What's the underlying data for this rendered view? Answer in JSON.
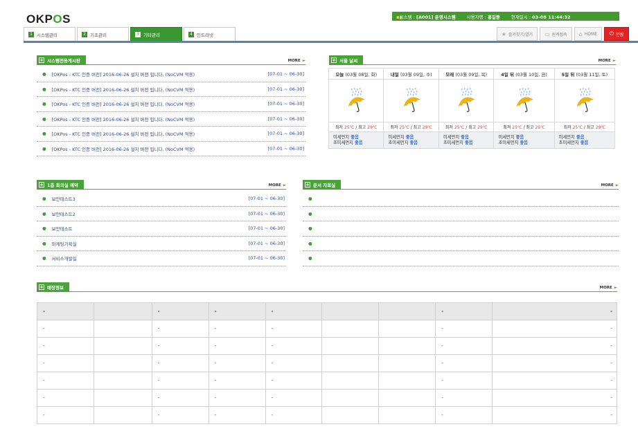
{
  "logo": {
    "left": "OKP",
    "o": "O",
    "right": "S"
  },
  "topinfo": {
    "system": "시스템 :",
    "system_value": "[A001] 운영시스템",
    "user": "사용자명 :",
    "user_value": "홍길동",
    "datetime": "현재일시 :",
    "datetime_value": "03-08 11:44:32"
  },
  "tabs": [
    {
      "num": "1",
      "label": "시스템관리"
    },
    {
      "num": "2",
      "label": "기초관리"
    },
    {
      "num": "3",
      "label": "기타관리"
    },
    {
      "num": "4",
      "label": "인트라넷"
    }
  ],
  "topbuttons": {
    "favorite": "즐겨찾기/열기",
    "remote": "원격접속",
    "home": "HOME",
    "close": "안뵘"
  },
  "notice": {
    "title": "시스템전용게시판",
    "more": "MORE",
    "items": [
      {
        "text": "[OKPos - KTC 인증 버전] 2016-06-26 설치 버전 입니다. (NoCVM 적용)",
        "date": "[07-01 ~ 06-30]"
      },
      {
        "text": "[OKPos - KTC 인증 버전] 2016-06-26 설치 버전 입니다. (NoCVM 적용)",
        "date": "[07-01 ~ 06-30]"
      },
      {
        "text": "[OKPos - KTC 인증 버전] 2016-06-26 설치 버전 입니다. (NoCVM 적용)",
        "date": "[07-01 ~ 06-30]"
      },
      {
        "text": "[OKPos - KTC 인증 버전] 2016-06-26 설치 버전 입니다. (NoCVM 적용)",
        "date": "[07-01 ~ 06-30]"
      },
      {
        "text": "[OKPos - KTC 인증 버전] 2016-06-26 설치 버전 입니다. (NoCVM 적용)",
        "date": "[07-01 ~ 06-30]"
      },
      {
        "text": "[OKPos - KTC 인증 버전] 2016-06-26 설치 버전 입니다. (NoCVM 적용)",
        "date": "[07-01 ~ 06-30]"
      }
    ]
  },
  "weather": {
    "title": "서울 날씨",
    "more": "MORE",
    "days": [
      {
        "name": "오늘",
        "date": "(03월 08일, 화)",
        "min": "25",
        "max": "29",
        "dust": "좋음",
        "fine": "좋음"
      },
      {
        "name": "내일",
        "date": "(03월 09일, 수)",
        "min": "25",
        "max": "29",
        "dust": "좋음",
        "fine": "좋음"
      },
      {
        "name": "모레",
        "date": "(03월 09일, 목)",
        "min": "25",
        "max": "29",
        "dust": "좋음",
        "fine": "좋음"
      },
      {
        "name": "4일 뒤",
        "date": "(03월 10일, 금)",
        "min": "25",
        "max": "29",
        "dust": "좋음",
        "fine": "좋음"
      },
      {
        "name": "5일 뒤",
        "date": "(03월 11일, 토)",
        "min": "25",
        "max": "29",
        "dust": "좋음",
        "fine": "좋음"
      }
    ],
    "min_label": "최저",
    "max_label": "최고",
    "unit": "℃",
    "dust_label": "미세먼지",
    "fine_label": "초미세먼지",
    "icon": "umbrella-rain-icon"
  },
  "meeting": {
    "title": "1층 회의실 예약",
    "more": "MORE",
    "items": [
      {
        "text": "보안테스트3",
        "date": "[07-01 ~ 06-30]"
      },
      {
        "text": "보안테스트2",
        "date": "[07-01 ~ 06-30]"
      },
      {
        "text": "보안테스트",
        "date": "[07-01 ~ 06-30]"
      },
      {
        "text": "마케팅기획실",
        "date": "[07-01 ~ 06-30]"
      },
      {
        "text": "서비스개발실",
        "date": "[07-01 ~ 06-30]"
      }
    ]
  },
  "docs": {
    "title": "문서 자료실",
    "more": "MORE",
    "items": [
      "",
      "",
      "",
      "",
      ""
    ]
  },
  "shop": {
    "title": "매장정보",
    "more": "MORE",
    "dash": "-"
  }
}
